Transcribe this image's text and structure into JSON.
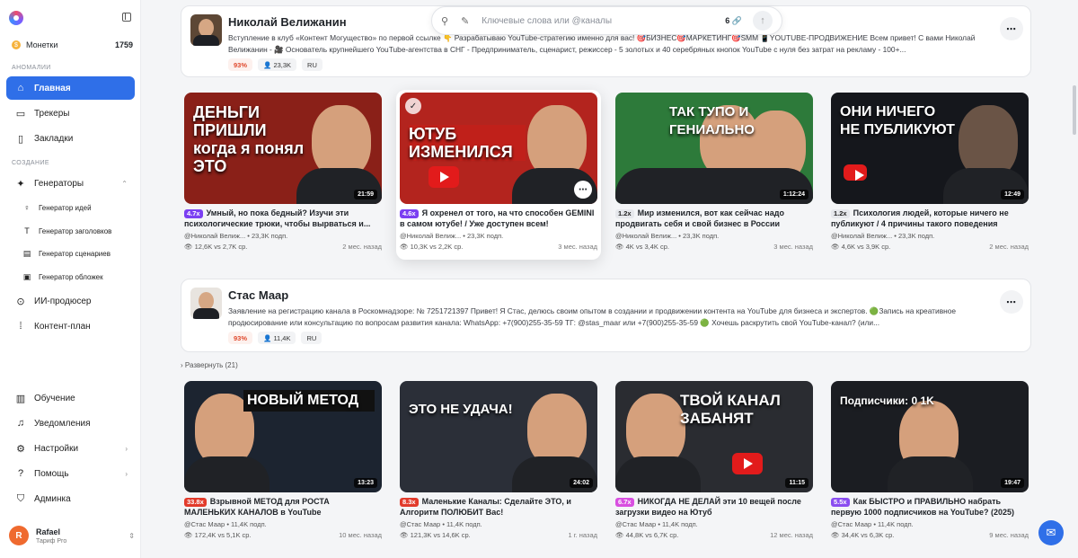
{
  "sidebar": {
    "coins_label": "Монетки",
    "coins_value": "1759",
    "section_anomalies": "АНОМАЛИИ",
    "section_create": "СОЗДАНИЕ",
    "nav_main": "Главная",
    "nav_trackers": "Трекеры",
    "nav_bookmarks": "Закладки",
    "nav_generators": "Генераторы",
    "sub_ideas": "Генератор идей",
    "sub_titles": "Генератор заголовков",
    "sub_scripts": "Генератор сценариев",
    "sub_covers": "Генератор обложек",
    "nav_producer": "ИИ-продюсер",
    "nav_plan": "Контент-план",
    "nav_learning": "Обучение",
    "nav_notifications": "Уведомления",
    "nav_settings": "Настройки",
    "nav_help": "Помощь",
    "nav_admin": "Админка",
    "user_initial": "R",
    "user_name": "Rafael",
    "user_plan": "Тариф Pro"
  },
  "search": {
    "placeholder": "Ключевые слова или @каналы",
    "count": "6 🔗"
  },
  "channels": [
    {
      "name": "Николай Велижанин",
      "desc": "Вступление в клуб «Контент Могущество» по первой ссылке 👇 Разрабатываю YouTube-стратегию именно для вас! 🎯БИЗНЕС🎯МАРКЕТИНГ🎯SMM 📱YOUTUBE-ПРОДВИЖЕНИЕ Всем привет! С вами Николай Велижанин - 🎥 Основатель крупнейшего YouTube-агентства в СНГ - Предприниматель, сценарист, режиссер - 5 золотых и 40 серебряных кнопок YouTube с нуля без затрат на рекламу - 100+...",
      "score": "93%",
      "subs": "👤 23,3K",
      "lang": "RU"
    },
    {
      "name": "Стас Маар",
      "desc": "Заявление на регистрацию канала в Роскомнадзоре: № 7251721397 Привет! Я Стас, делюсь своим опытом в создании и продвижении контента на YouTube для бизнеса и экспертов. 🟢Запись на креативное продюсирование или консультацию по вопросам развития канала: WhatsApp: +7(900)255-35-59 ТГ: @stas_maar или +7(900)255-35-59 🟢 Хочешь раскрутить свой YouTube-канал? (или...",
      "score": "93%",
      "subs": "👤 11,4K",
      "lang": "RU"
    }
  ],
  "expand_label": "Развернуть (21)",
  "videos_row1": [
    {
      "thumb": "ДЕНЬГИ ПРИШЛИ когда я понял ЭТО",
      "dur": "21:59",
      "mult": "4.7x",
      "title": "Умный, но пока бедный? Изучи эти психологические трюки, чтобы вырваться и...",
      "channel": "@Николай Велиж...",
      "subs": "23,3K подп.",
      "views": "👁 12,6K vs 2,7K ср.",
      "ago": "2 мес. назад"
    },
    {
      "thumb": "ЮТУБ ИЗМЕНИЛСЯ",
      "dur": "",
      "mult": "4.6x",
      "title": "Я охренел от того, на что способен GEMINI в самом ютубе! / Уже доступен всем!",
      "channel": "@Николай Велиж...",
      "subs": "23,3K подп.",
      "views": "👁 10,3K vs 2,2K ср.",
      "ago": "3 мес. назад"
    },
    {
      "thumb": "ТАК ТУПО И ГЕНИАЛЬНО",
      "dur": "1:12:24",
      "mult": "1.2x",
      "title": "Мир изменился, вот как сейчас надо продвигать себя и свой бизнес в России",
      "channel": "@Николай Велиж...",
      "subs": "23,3K подп.",
      "views": "👁 4K vs 3,4K ср.",
      "ago": "3 мес. назад"
    },
    {
      "thumb": "ОНИ НИЧЕГО НЕ ПУБЛИКУЮТ",
      "dur": "12:49",
      "mult": "1.2x",
      "title": "Психология людей, которые ничего не публикуют / 4 причины такого поведения",
      "channel": "@Николай Велиж...",
      "subs": "23,3K подп.",
      "views": "👁 4,6K vs 3,9K ср.",
      "ago": "2 мес. назад"
    }
  ],
  "videos_row2": [
    {
      "thumb": "НОВЫЙ МЕТОД",
      "dur": "13:23",
      "mult": "33.8x",
      "title": "Взрывной МЕТОД для РОСТА МАЛЕНЬКИХ КАНАЛОВ в YouTube",
      "channel": "@Стас Маар",
      "subs": "11,4K подп.",
      "views": "👁 172,4K vs 5,1K ср.",
      "ago": "10 мес. назад"
    },
    {
      "thumb": "ЭТО НЕ УДАЧА!",
      "dur": "24:02",
      "mult": "8.3x",
      "title": "Маленькие Каналы: Сделайте ЭТО, и Алгоритм ПОЛЮБИТ Вас!",
      "channel": "@Стас Маар",
      "subs": "11,4K подп.",
      "views": "👁 121,3K vs 14,6K ср.",
      "ago": "1 г. назад"
    },
    {
      "thumb": "ТВОЙ КАНАЛ ЗАБАНЯТ",
      "dur": "11:15",
      "mult": "6.7x",
      "title": "НИКОГДА НЕ ДЕЛАЙ эти 10 вещей после загрузки видео на Ютуб",
      "channel": "@Стас Маар",
      "subs": "11,4K подп.",
      "views": "👁 44,8K vs 6,7K ср.",
      "ago": "12 мес. назад"
    },
    {
      "thumb": "Подписчики: 0 1K",
      "dur": "19:47",
      "mult": "5.5x",
      "title": "Как БЫСТРО и ПРАВИЛЬНО набрать первую 1000 подписчиков на YouTube? (2025)",
      "channel": "@Стас Маар",
      "subs": "11,4K подп.",
      "views": "👁 34,4K vs 6,3K ср.",
      "ago": "9 мес. назад"
    }
  ],
  "colors": {
    "accent": "#2f6fe8",
    "multiplier": "#7b3ff2",
    "score": "#e04a2e"
  }
}
